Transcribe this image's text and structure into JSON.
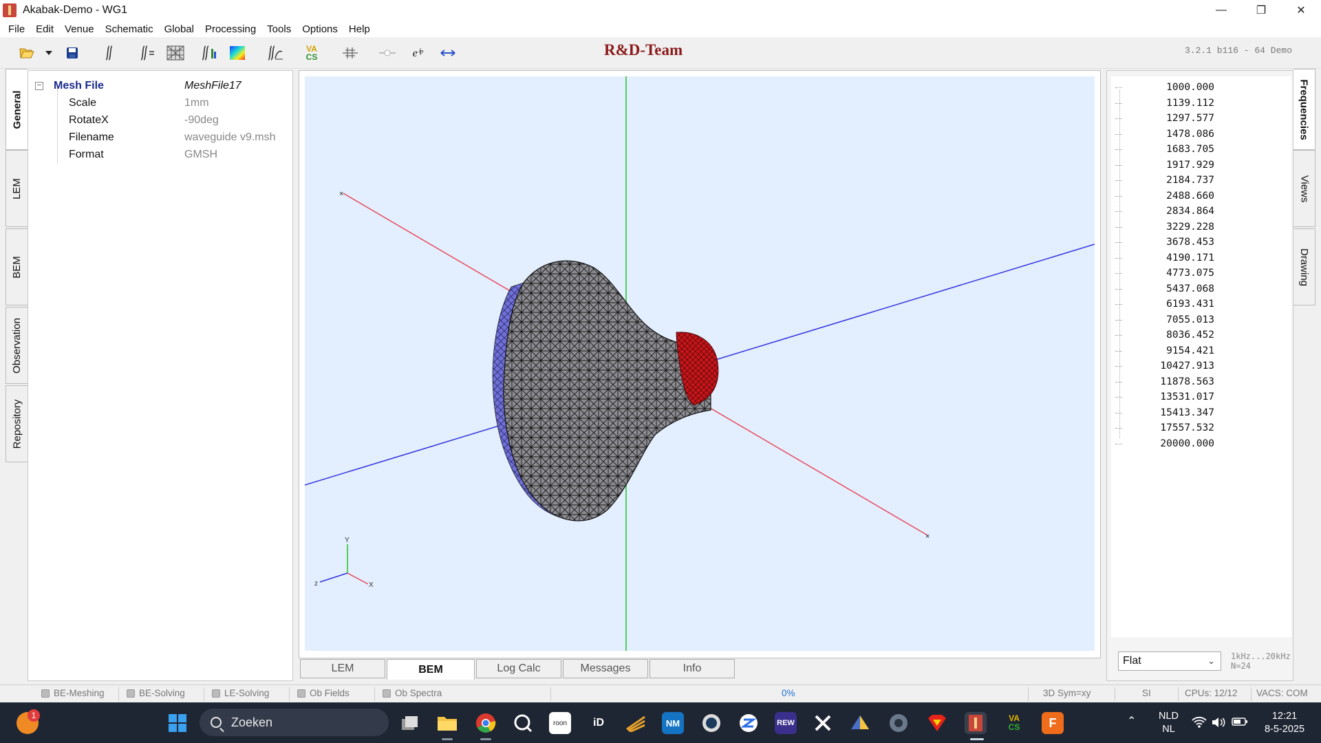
{
  "window": {
    "title": "Akabak-Demo - WG1",
    "minimize": "—",
    "maximize": "❐",
    "close": "✕"
  },
  "menu": [
    "File",
    "Edit",
    "Venue",
    "Schematic",
    "Global",
    "Processing",
    "Tools",
    "Options",
    "Help"
  ],
  "toolbar": {
    "team_title": "R&D-Team",
    "version": "3.2.1 b116 - 64 Demo",
    "icons": [
      "open-folder-icon",
      "dropdown-arrow-icon",
      "save-icon",
      "integral-icon",
      "integral-list-icon",
      "mesh-grid-icon",
      "integral-bars-icon",
      "color-map-icon",
      "integral-curve-icon",
      "vacs-icon",
      "align-icon",
      "node-icon",
      "exp-icon",
      "arrow-both-icon"
    ],
    "vacs_top": "VA",
    "vacs_bottom": "CS",
    "exp_label": "eⁱᵖ"
  },
  "left_tabs": [
    "General",
    "LEM",
    "BEM",
    "Observation",
    "Repository"
  ],
  "properties": {
    "header_key": "Mesh File",
    "header_value": "MeshFile17",
    "rows": [
      {
        "key": "Scale",
        "value": "1mm"
      },
      {
        "key": "RotateX",
        "value": "-90deg"
      },
      {
        "key": "Filename",
        "value": "waveguide v9.msh"
      },
      {
        "key": "Format",
        "value": "GMSH"
      }
    ]
  },
  "viewport": {
    "axis_y": "Y",
    "axis_x": "X",
    "axis_z": "z",
    "marker": "×",
    "colors": {
      "background": "#e3efff",
      "x_axis": "#e84a5a",
      "y_axis": "#22c422",
      "z_axis": "#3333dd",
      "mesh_fill": "#8a8a90",
      "mesh_edge": "#1a1a1a",
      "rim": "#6a6ad8",
      "throat": "#c8161b"
    }
  },
  "bottom_tabs": [
    "LEM",
    "BEM",
    "Log Calc",
    "Messages",
    "Info"
  ],
  "active_bottom_tab": "BEM",
  "right_tabs": [
    "Frequencies",
    "Views",
    "Drawing"
  ],
  "frequencies": [
    "1000.000",
    "1139.112",
    "1297.577",
    "1478.086",
    "1683.705",
    "1917.929",
    "2184.737",
    "2488.660",
    "2834.864",
    "3229.228",
    "3678.453",
    "4190.171",
    "4773.075",
    "5437.068",
    "6193.431",
    "7055.013",
    "8036.452",
    "9154.421",
    "10427.913",
    "11878.563",
    "13531.017",
    "15413.347",
    "17557.532",
    "20000.000"
  ],
  "freq_mode": "Flat",
  "freq_range": "1kHz...20kHz",
  "freq_count": "N=24",
  "status": {
    "indicators": [
      "BE-Meshing",
      "BE-Solving",
      "LE-Solving",
      "Ob Fields",
      "Ob Spectra"
    ],
    "progress": "0%",
    "sym": "3D Sym=xy",
    "units": "SI",
    "cpus": "CPUs: 12/12",
    "vacs": "VACS: COM"
  },
  "taskbar": {
    "search_placeholder": "Zoeken",
    "badge": "1",
    "lang_top": "NLD",
    "lang_bottom": "NL",
    "time": "12:21",
    "date": "8-5-2025",
    "apps": [
      "windows-start-icon",
      "task-view-icon",
      "file-explorer-icon",
      "chrome-icon",
      "qobuz-icon",
      "roon-icon",
      "id-icon",
      "sweep-icon",
      "nm-icon",
      "circle-app-icon",
      "zoom-icon",
      "rew-icon",
      "xsim-icon",
      "pyramid-icon",
      "speaker-icon",
      "superman-icon",
      "akabak-icon",
      "vacs-icon",
      "fusion-icon"
    ],
    "rew_label": "REW",
    "nm_label": "NM",
    "id_label": "iD",
    "roon_label": "roon",
    "fusion_label": "F",
    "vacs_top": "VA",
    "vacs_bottom": "CS"
  }
}
